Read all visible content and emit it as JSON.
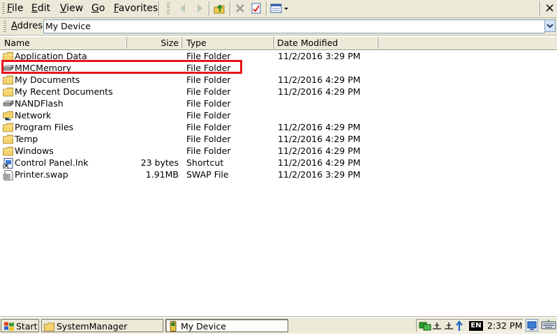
{
  "menu": {
    "file": "File",
    "edit": "Edit",
    "view": "View",
    "go": "Go",
    "favorites": "Favorites"
  },
  "toolbar": {
    "back_icon": "back-arrow-icon",
    "forward_icon": "forward-arrow-icon",
    "up_icon": "up-folder-icon",
    "delete_icon": "delete-x-icon",
    "properties_icon": "properties-icon",
    "views_icon": "views-menu-icon",
    "close_label": "×"
  },
  "address": {
    "label": "Address",
    "value": "My Device"
  },
  "columns": [
    "Name",
    "Size",
    "Type",
    "Date Modified"
  ],
  "files": [
    {
      "icon": "folder-icon",
      "name": "Application Data",
      "size": "",
      "type": "File Folder",
      "date": "11/2/2016 3:29 PM"
    },
    {
      "icon": "storage-card-icon",
      "name": "MMCMemory",
      "size": "",
      "type": "File Folder",
      "date": ""
    },
    {
      "icon": "folder-icon",
      "name": "My Documents",
      "size": "",
      "type": "File Folder",
      "date": "11/2/2016 4:29 PM"
    },
    {
      "icon": "folder-icon",
      "name": "My Recent Documents",
      "size": "",
      "type": "File Folder",
      "date": "11/2/2016 4:29 PM"
    },
    {
      "icon": "storage-card-icon",
      "name": "NANDFlash",
      "size": "",
      "type": "File Folder",
      "date": ""
    },
    {
      "icon": "network-folder-icon",
      "name": "Network",
      "size": "",
      "type": "File Folder",
      "date": ""
    },
    {
      "icon": "folder-icon",
      "name": "Program Files",
      "size": "",
      "type": "File Folder",
      "date": "11/2/2016 4:29 PM"
    },
    {
      "icon": "folder-icon",
      "name": "Temp",
      "size": "",
      "type": "File Folder",
      "date": "11/2/2016 4:29 PM"
    },
    {
      "icon": "folder-icon",
      "name": "Windows",
      "size": "",
      "type": "File Folder",
      "date": "11/2/2016 4:29 PM"
    },
    {
      "icon": "shortcut-icon",
      "name": "Control Panel.lnk",
      "size": "23 bytes",
      "type": "Shortcut",
      "date": "11/2/2016 4:29 PM"
    },
    {
      "icon": "swap-file-icon",
      "name": "Printer.swap",
      "size": "1.91MB",
      "type": "SWAP File",
      "date": "11/2/2016 3:29 PM"
    }
  ],
  "taskbar": {
    "start_label": "Start",
    "tasks": [
      {
        "icon": "folder-icon",
        "label": "SystemManager"
      },
      {
        "icon": "device-icon",
        "label": "My Device"
      }
    ],
    "language": "EN",
    "clock": "2:32 PM"
  },
  "colors": {
    "chrome": "#ece9d8",
    "highlight": "#e8141a",
    "folder": "#f5d36c"
  }
}
